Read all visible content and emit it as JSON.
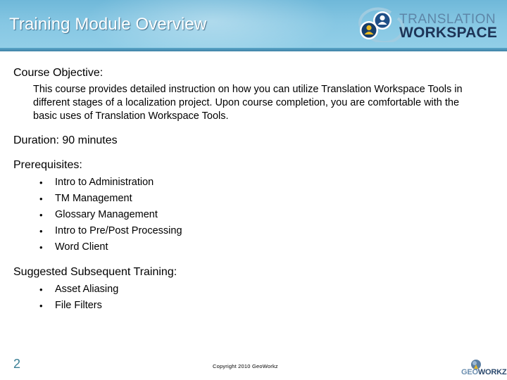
{
  "header": {
    "title": "Training Module Overview",
    "logo": {
      "line1": "TRANSLATION",
      "line2": "WORKSPACE",
      "icon": "users-cycle-icon"
    }
  },
  "objective": {
    "heading": "Course Objective:",
    "text": "This course provides detailed instruction on how you can utilize Translation Workspace Tools in different stages of a localization project. Upon course completion, you are comfortable with the basic uses of Translation Workspace Tools."
  },
  "duration": {
    "label": "Duration: 90 minutes"
  },
  "prerequisites": {
    "heading": "Prerequisites:",
    "items": [
      "Intro to Administration",
      "TM Management",
      "Glossary Management",
      "Intro to Pre/Post Processing",
      "Word Client"
    ]
  },
  "subsequent": {
    "heading": "Suggested Subsequent Training:",
    "items": [
      "Asset Aliasing",
      "File Filters"
    ]
  },
  "footer": {
    "page_number": "2",
    "copyright": "Copyright 2010 GeoWorkz",
    "logo_part1": "GEO",
    "logo_part2": "WORKZ"
  },
  "colors": {
    "header_blue": "#86c7e3",
    "page_number": "#3a7f95",
    "logo_dark": "#1d3457",
    "logo_light": "#5d86a8"
  },
  "bullet_glyph": "•"
}
